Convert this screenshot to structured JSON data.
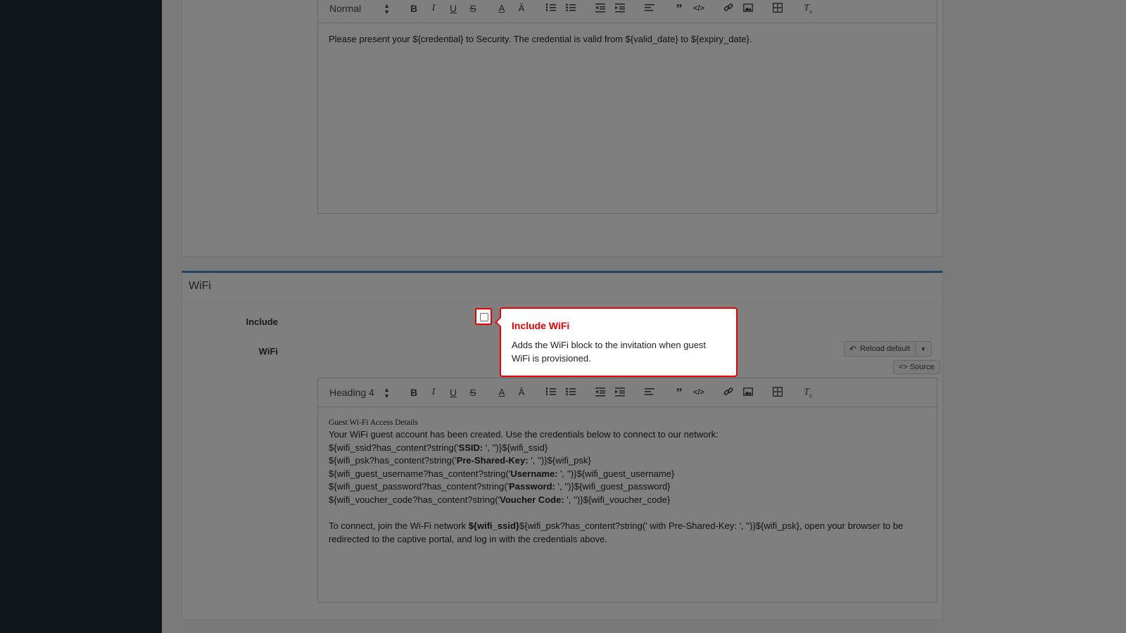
{
  "top_editor": {
    "format_select": "Normal",
    "content": "Please present your ${credential} to Security. The credential is valid from ${valid_date} to ${expiry_date}."
  },
  "wifi_panel": {
    "title": "WiFi",
    "include_label": "Include",
    "wifi_label": "WiFi",
    "reload_default_label": "Reload default",
    "source_label": "<> Source",
    "editor": {
      "format_select": "Heading 4",
      "heading": "Guest Wi-Fi Access Details",
      "intro": "Your WiFi guest account has been created. Use the credentials below to connect to our network:",
      "lines": [
        {
          "pre": "${wifi_ssid?has_content?string('",
          "bold": "SSID:",
          "post": " ', '')}${wifi_ssid}"
        },
        {
          "pre": "${wifi_psk?has_content?string('",
          "bold": "Pre-Shared-Key:",
          "post": " ', '')}${wifi_psk}"
        },
        {
          "pre": "${wifi_guest_username?has_content?string('",
          "bold": "Username:",
          "post": "  ', '')}${wifi_guest_username}"
        },
        {
          "pre": "${wifi_guest_password?has_content?string('",
          "bold": "Password:",
          "post": " ', '')}${wifi_guest_password}"
        },
        {
          "pre": "${wifi_voucher_code?has_content?string('",
          "bold": "Voucher Code:",
          "post": " ', '')}${wifi_voucher_code}"
        }
      ],
      "connect_pre": "To connect, join the Wi-Fi network ",
      "connect_bold": "${wifi_ssid}",
      "connect_post": "${wifi_psk?has_content?string(' with Pre-Shared-Key: ', '')}${wifi_psk}, open your browser to be redirected to the captive portal, and log in with the credentials above."
    }
  },
  "popover": {
    "title": "Include WiFi",
    "body": "Adds the WiFi block to the invitation when guest WiFi is provisioned."
  },
  "colors": {
    "sidebar": "#1c2b36",
    "accent": "#3c8dbc",
    "highlight": "#e00000"
  }
}
